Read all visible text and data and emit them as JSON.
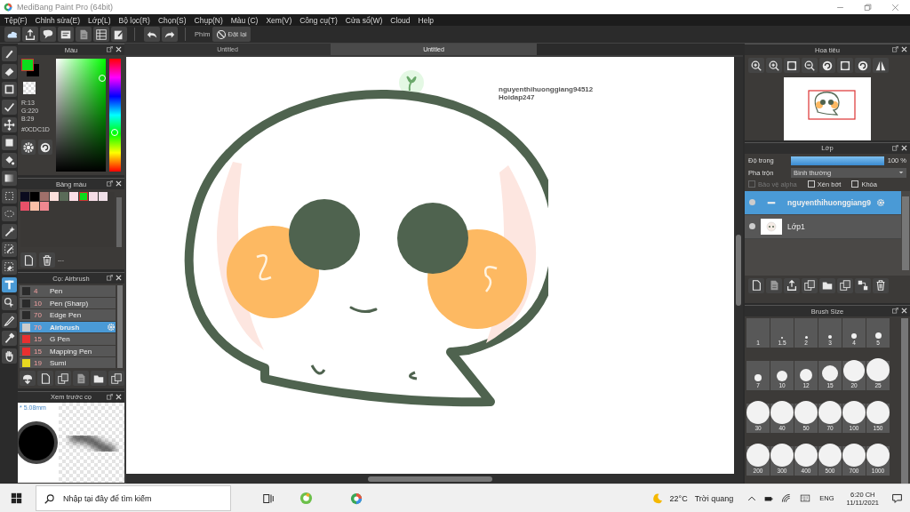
{
  "window": {
    "title": "MediBang Paint Pro (64bit)"
  },
  "menu": [
    "Tệp(F)",
    "Chỉnh sửa(E)",
    "Lớp(L)",
    "Bộ lọc(R)",
    "Chọn(S)",
    "Chụp(N)",
    "Màu (C)",
    "Xem(V)",
    "Công cụ(T)",
    "Cửa sổ(W)",
    "Cloud",
    "Help"
  ],
  "toolbar": {
    "shortcut_label": "Phím",
    "reset_button": "Đặt lại"
  },
  "tools": [
    {
      "kind": "brush",
      "selected": false
    },
    {
      "kind": "eraser",
      "selected": false
    },
    {
      "kind": "square",
      "selected": false
    },
    {
      "kind": "dotline",
      "selected": false
    },
    {
      "kind": "move",
      "selected": false
    },
    {
      "kind": "fill",
      "selected": false
    },
    {
      "kind": "bucket",
      "selected": false
    },
    {
      "kind": "gradient",
      "selected": false
    },
    {
      "kind": "selection",
      "selected": false
    },
    {
      "kind": "lasso",
      "selected": false
    },
    {
      "kind": "wand",
      "selected": false
    },
    {
      "kind": "selectpen",
      "selected": false
    },
    {
      "kind": "selecteraser",
      "selected": false
    },
    {
      "kind": "text",
      "selected": true
    },
    {
      "kind": "pointer",
      "selected": false
    },
    {
      "kind": "pen",
      "selected": false
    },
    {
      "kind": "eyedropper",
      "selected": false
    },
    {
      "kind": "hand",
      "selected": false
    }
  ],
  "color_panel": {
    "title": "Màu",
    "red": "R:13",
    "green": "G:220",
    "blue": "B:29",
    "hex": "#0CDC1D",
    "hue_slider": {
      "level": 0.35
    }
  },
  "palette": {
    "title": "Bảng màu",
    "info": "---",
    "swatches": [
      {
        "color": "#0b0b1e",
        "selected": false
      },
      {
        "color": "#000000",
        "selected": false
      },
      {
        "color": "#a0706a",
        "selected": false
      },
      {
        "color": "#fde0dc",
        "selected": false
      },
      {
        "color": "#5a6b58",
        "selected": false
      },
      {
        "color": "#fde0e8",
        "selected": false
      },
      {
        "color": "#0cdc1d",
        "selected": true
      },
      {
        "color": "#f5dde6",
        "selected": false
      },
      {
        "color": "#f0e0e8",
        "selected": false
      },
      {
        "color": "#e85068",
        "selected": false
      },
      {
        "color": "#fac0a8",
        "selected": false
      },
      {
        "color": "#f08890",
        "selected": false
      }
    ]
  },
  "brushes": {
    "title": "Cọ: Airbrush",
    "items": [
      {
        "size": "4",
        "name": "Pen",
        "color": "#2a2a2a",
        "selected": false
      },
      {
        "size": "10",
        "name": "Pen (Sharp)",
        "color": "#2a2a2a",
        "selected": false
      },
      {
        "size": "70",
        "name": "Edge Pen",
        "color": "#2a2a2a",
        "selected": false
      },
      {
        "size": "70",
        "name": "Airbrush",
        "color": "#cccccc",
        "selected": true
      },
      {
        "size": "15",
        "name": "G Pen",
        "color": "#e83030",
        "selected": false
      },
      {
        "size": "15",
        "name": "Mapping Pen",
        "color": "#e83030",
        "selected": false
      },
      {
        "size": "19",
        "name": "Sumi",
        "color": "#e8d820",
        "selected": false
      }
    ]
  },
  "brush_preview": {
    "title": "Xem trước cọ",
    "size": "* 5.08mm"
  },
  "canvas": {
    "tabs": [
      {
        "label": "Untitled",
        "selected": false
      },
      {
        "label": "Untitled",
        "selected": true
      }
    ],
    "text_lines": [
      "nguyenthihuonggiang94512",
      "Hoidap247"
    ]
  },
  "navigator": {
    "title": "Hoa tiêu"
  },
  "layers": {
    "title": "Lớp",
    "opacity_label": "Độ trong",
    "level": 1.0,
    "opacity_value": "100 %",
    "blend_label": "Pha trộn",
    "blend_value": "Bình thường",
    "options": [
      {
        "label": "Bảo vệ alpha",
        "checked": false,
        "disabled": true
      },
      {
        "label": "Xén bớt",
        "checked": false,
        "disabled": false
      },
      {
        "label": "Khóa",
        "checked": false,
        "disabled": false
      }
    ],
    "items": [
      {
        "name": "nguyenthihuonggiang9",
        "kind": "text",
        "selected": true
      },
      {
        "name": "Lớp1",
        "kind": "image",
        "selected": false
      }
    ]
  },
  "brush_size": {
    "title": "Brush Size",
    "sizes": [
      "1",
      "1.5",
      "2",
      "3",
      "4",
      "5",
      "7",
      "10",
      "12",
      "15",
      "20",
      "25",
      "30",
      "40",
      "50",
      "70",
      "100",
      "150",
      "200",
      "300",
      "400",
      "500",
      "700",
      "1000"
    ]
  },
  "taskbar": {
    "search_placeholder": "Nhập tại đây để tìm kiếm",
    "temperature": "22°C",
    "weather": "Trời quang",
    "language": "ENG",
    "time": "6:20 CH",
    "date": "11/11/2021"
  }
}
